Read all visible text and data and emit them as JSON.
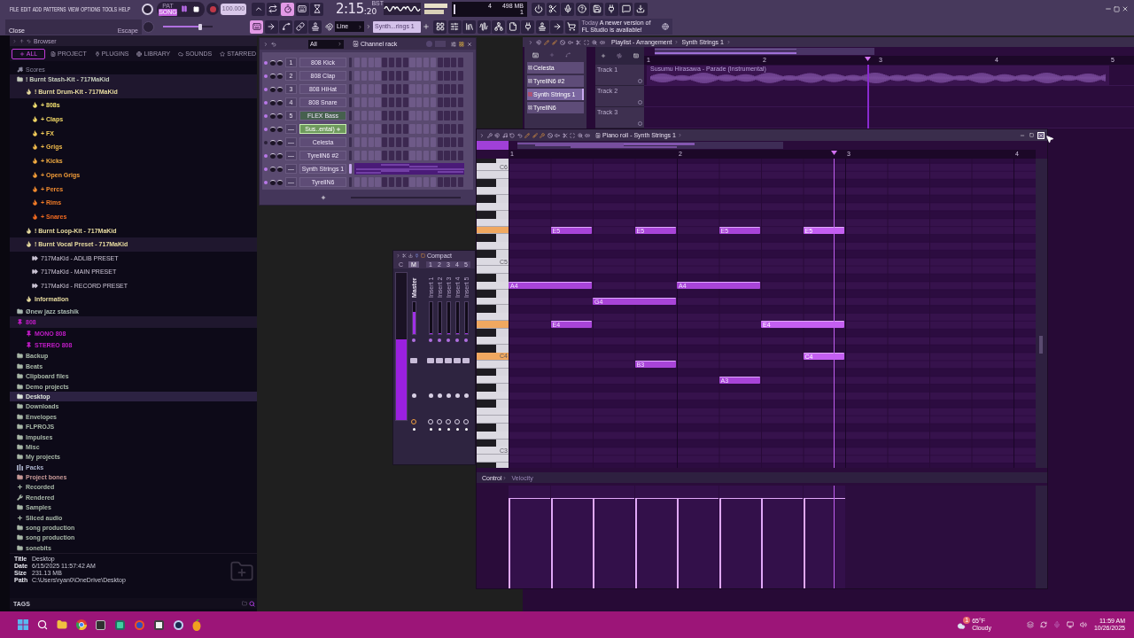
{
  "menu": {
    "items": [
      "FILE",
      "EDIT",
      "ADD",
      "PATTERNS",
      "VIEW",
      "OPTIONS",
      "TOOLS",
      "HELP"
    ],
    "hint": "Close",
    "shortcut": "Escape"
  },
  "transport": {
    "modes": [
      {
        "label": "PAT",
        "selected": false
      },
      {
        "label": "SONG",
        "selected": true
      }
    ],
    "playing": true,
    "recording": false,
    "tempo": "100.000",
    "time": "2:15",
    "ticks": ":20",
    "time_unit": "BST",
    "master_pitch": {
      "level": 0.75
    },
    "toggles": [
      {
        "on": false
      },
      {
        "on": false
      },
      {
        "on": true
      },
      {
        "on": false
      },
      {
        "on": false
      }
    ],
    "edit_toggles": [
      {
        "on": true
      },
      {
        "on": false
      },
      {
        "on": false
      },
      {
        "on": false
      },
      {
        "on": false
      }
    ],
    "snap": "Line",
    "pattern": "Synth...rings 1"
  },
  "cpu": {
    "cores": "4",
    "memory": "498 MB",
    "polyphony": "1"
  },
  "notification": {
    "day": "Today",
    "text": "A newer version of FL Studio is available!"
  },
  "browser": {
    "title": "Browser",
    "tabs": [
      {
        "label": "ALL",
        "selected": true
      },
      {
        "label": "PROJECT",
        "selected": false
      },
      {
        "label": "PLUGINS",
        "selected": false
      },
      {
        "label": "LIBRARY",
        "selected": false
      },
      {
        "label": "SOUNDS",
        "selected": false
      },
      {
        "label": "STARRED",
        "selected": false
      }
    ],
    "tree": [
      {
        "label": "Scores",
        "kind": "note",
        "color": "#8c8aa0",
        "selected": false,
        "expanded": false
      },
      {
        "label": "! Burnt Stash-Kit - 717MaKid",
        "kind": "folder",
        "color": "#c4ccbc",
        "selected": false,
        "expanded": true,
        "children": [
          {
            "label": "! Burnt Drum-Kit - 717MaKid",
            "kind": "flame",
            "color": "#e8dca0",
            "selected": false,
            "expanded": true,
            "children": [
              {
                "label": "+ 808s",
                "kind": "flame",
                "color": "#f2e070",
                "selected": false,
                "expanded": false
              },
              {
                "label": "+ Claps",
                "kind": "flame",
                "color": "#f2d866",
                "selected": false,
                "expanded": false
              },
              {
                "label": "+ FX",
                "kind": "flame",
                "color": "#f2cc5a",
                "selected": false,
                "expanded": false
              },
              {
                "label": "+ Grigs",
                "kind": "flame",
                "color": "#f2bc4c",
                "selected": false,
                "expanded": false
              },
              {
                "label": "+ Kicks",
                "kind": "flame",
                "color": "#f2ac42",
                "selected": false,
                "expanded": false
              },
              {
                "label": "+ Open Grigs",
                "kind": "flame",
                "color": "#f29c38",
                "selected": false,
                "expanded": false
              },
              {
                "label": "+ Percs",
                "kind": "flame",
                "color": "#f28c30",
                "selected": false,
                "expanded": false
              },
              {
                "label": "+ Rims",
                "kind": "flame",
                "color": "#f27c28",
                "selected": false,
                "expanded": false
              },
              {
                "label": "+ Snares",
                "kind": "flame",
                "color": "#f26a20",
                "selected": false,
                "expanded": false
              }
            ]
          },
          {
            "label": "! Burnt Loop-Kit - 717MaKid",
            "kind": "flame",
            "color": "#e8dca0",
            "selected": false,
            "expanded": false
          },
          {
            "label": "! Burnt Vocal Preset - 717MaKid",
            "kind": "flame",
            "color": "#e8dca0",
            "selected": false,
            "expanded": true,
            "children": [
              {
                "label": "717MaKid - ADLIB PRESET",
                "kind": "preset",
                "color": "#cfc8d8",
                "selected": false,
                "expanded": false
              },
              {
                "label": "717MaKid - MAIN PRESET",
                "kind": "preset",
                "color": "#cfc8d8",
                "selected": false,
                "expanded": false
              },
              {
                "label": "717MaKid - RECORD PRESET",
                "kind": "preset",
                "color": "#cfc8d8",
                "selected": false,
                "expanded": false
              }
            ]
          },
          {
            "label": "Information",
            "kind": "flame",
            "color": "#e8dca0",
            "selected": false,
            "expanded": false
          }
        ]
      },
      {
        "label": "Ønew jazz stashik",
        "kind": "folder",
        "color": "#a8b8b0",
        "selected": false,
        "expanded": false
      },
      {
        "label": "808",
        "kind": "pin",
        "color": "#c21cc8",
        "selected": false,
        "expanded": true,
        "children": [
          {
            "label": "MONO 808",
            "kind": "pin",
            "color": "#c21cc8",
            "selected": false,
            "expanded": false
          },
          {
            "label": "STEREO 808",
            "kind": "pin",
            "color": "#c21cc8",
            "selected": false,
            "expanded": false
          }
        ]
      },
      {
        "label": "Backup",
        "kind": "folder",
        "color": "#a8b8a8",
        "selected": false,
        "expanded": false
      },
      {
        "label": "Beats",
        "kind": "folder",
        "color": "#a8b8a8",
        "selected": false,
        "expanded": false
      },
      {
        "label": "Clipboard files",
        "kind": "folder",
        "color": "#a8b8a8",
        "selected": false,
        "expanded": false
      },
      {
        "label": "Demo projects",
        "kind": "folder",
        "color": "#a8b8a8",
        "selected": false,
        "expanded": false
      },
      {
        "label": "Desktop",
        "kind": "folder",
        "color": "#dce4dc",
        "selected": true,
        "expanded": false
      },
      {
        "label": "Downloads",
        "kind": "folder",
        "color": "#a8b8a8",
        "selected": false,
        "expanded": false
      },
      {
        "label": "Envelopes",
        "kind": "folder",
        "color": "#a8b8a8",
        "selected": false,
        "expanded": false
      },
      {
        "label": "FLPROJS",
        "kind": "folder",
        "color": "#a8b8a8",
        "selected": false,
        "expanded": false
      },
      {
        "label": "Impulses",
        "kind": "folder",
        "color": "#a8b8a8",
        "selected": false,
        "expanded": false
      },
      {
        "label": "Misc",
        "kind": "folder",
        "color": "#a8b8a8",
        "selected": false,
        "expanded": false
      },
      {
        "label": "My projects",
        "kind": "folder",
        "color": "#a8b8a8",
        "selected": false,
        "expanded": false
      },
      {
        "label": "Packs",
        "kind": "packs",
        "color": "#a8b0c8",
        "selected": false,
        "expanded": false
      },
      {
        "label": "Project bones",
        "kind": "folder",
        "color": "#c89a98",
        "selected": false,
        "expanded": false
      },
      {
        "label": "Recorded",
        "kind": "plus",
        "color": "#a8b8a8",
        "selected": false,
        "expanded": false
      },
      {
        "label": "Rendered",
        "kind": "tool",
        "color": "#a8b8a8",
        "selected": false,
        "expanded": false
      },
      {
        "label": "Samples",
        "kind": "folder",
        "color": "#a8b8a8",
        "selected": false,
        "expanded": false
      },
      {
        "label": "Sliced audio",
        "kind": "plus",
        "color": "#a8b8a8",
        "selected": false,
        "expanded": false
      },
      {
        "label": "song production",
        "kind": "folder",
        "color": "#a8b8a8",
        "selected": false,
        "expanded": false
      },
      {
        "label": "song production",
        "kind": "folder",
        "color": "#a8b8a8",
        "selected": false,
        "expanded": false
      },
      {
        "label": "sonebits",
        "kind": "folder",
        "color": "#a8b8a8",
        "selected": false,
        "expanded": false
      }
    ],
    "info": [
      {
        "label": "Title",
        "value": "Desktop"
      },
      {
        "label": "Date",
        "value": "6/15/2025 11:57:42 AM"
      },
      {
        "label": "Size",
        "value": "231.13 MB"
      },
      {
        "label": "Path",
        "value": "C:\\Users\\ryan0\\OneDrive\\Desktop"
      }
    ],
    "tags": "TAGS"
  },
  "channel_rack": {
    "filter": "All",
    "title": "Channel rack",
    "channels": [
      {
        "number": "1",
        "name": "808 Kick",
        "color": "#5e4c76",
        "enabled": true,
        "selected": false,
        "hovered": false,
        "kind": "steps"
      },
      {
        "number": "2",
        "name": "808 Clap",
        "color": "#5e4c76",
        "enabled": true,
        "selected": false,
        "hovered": false,
        "kind": "steps"
      },
      {
        "number": "3",
        "name": "808 HiHat",
        "color": "#5e4c76",
        "enabled": true,
        "selected": false,
        "hovered": false,
        "kind": "steps"
      },
      {
        "number": "4",
        "name": "808 Snare",
        "color": "#5e4c76",
        "enabled": true,
        "selected": false,
        "hovered": false,
        "kind": "steps"
      },
      {
        "number": "5",
        "name": "FLEX Bass",
        "color": "#46604e",
        "enabled": true,
        "selected": false,
        "hovered": false,
        "kind": "steps"
      },
      {
        "number": "—",
        "name": "Sus..ental)",
        "color": "#6e9a5c",
        "enabled": true,
        "selected": false,
        "hovered": true,
        "kind": "steps"
      },
      {
        "number": "—",
        "name": "Celesta",
        "color": "#5e4c76",
        "enabled": false,
        "selected": false,
        "hovered": false,
        "kind": "steps"
      },
      {
        "number": "—",
        "name": "TyrellN6 #2",
        "color": "#5e4c76",
        "enabled": true,
        "selected": false,
        "hovered": false,
        "kind": "steps"
      },
      {
        "number": "—",
        "name": "Synth Strings 1",
        "color": "#5e4c76",
        "enabled": true,
        "selected": true,
        "hovered": false,
        "kind": "pianoroll"
      },
      {
        "number": "—",
        "name": "TyrellN6",
        "color": "#5e4c76",
        "enabled": true,
        "selected": false,
        "hovered": false,
        "kind": "steps"
      }
    ]
  },
  "mixer": {
    "view": "Compact",
    "current": "C",
    "meter": {
      "level": 0.55
    },
    "tracks": [
      {
        "number": "M",
        "name": "Master",
        "kind": "master",
        "level": 0.7
      },
      {
        "number": "1",
        "name": "Insert 1",
        "kind": "insert",
        "level": 0
      },
      {
        "number": "2",
        "name": "Insert 2",
        "kind": "insert",
        "level": 0
      },
      {
        "number": "3",
        "name": "Insert 3",
        "kind": "insert",
        "level": 0
      },
      {
        "number": "4",
        "name": "Insert 4",
        "kind": "insert",
        "level": 0
      },
      {
        "number": "5",
        "name": "Insert 5",
        "kind": "insert",
        "level": 0
      }
    ]
  },
  "playlist": {
    "title": "Playlist - Arrangement",
    "pattern": "Synth Strings 1",
    "patterns": [
      {
        "name": "Celesta",
        "selected": false
      },
      {
        "name": "TyrellN6 #2",
        "selected": false
      },
      {
        "name": "Synth Strings 1",
        "selected": true
      },
      {
        "name": "TyrellN6",
        "selected": false
      }
    ],
    "ruler": [
      "1",
      "2",
      "3",
      "4",
      "5"
    ],
    "tracks": [
      {
        "name": "Track 1",
        "clip": "Susumu Hirasawa - Parade (Instrumental)"
      },
      {
        "name": "Track 2"
      },
      {
        "name": "Track 3"
      }
    ]
  },
  "piano_roll": {
    "title": "Piano roll - Synth Strings 1",
    "ruler": [
      "1",
      "2",
      "3",
      "4"
    ],
    "key_labels": [
      "C6",
      "C5",
      "C4",
      "C3"
    ],
    "notes": [
      {
        "label": "E5",
        "playing": false
      },
      {
        "label": "E5",
        "playing": false
      },
      {
        "label": "E5",
        "playing": false
      },
      {
        "label": "E5",
        "playing": true
      },
      {
        "label": "A4",
        "playing": false
      },
      {
        "label": "A4",
        "playing": false
      },
      {
        "label": "G4",
        "playing": false
      },
      {
        "label": "E4",
        "playing": false
      },
      {
        "label": "E4",
        "playing": true
      },
      {
        "label": "C4",
        "playing": true
      },
      {
        "label": "B3",
        "playing": false
      },
      {
        "label": "A3",
        "playing": false
      }
    ],
    "control": "Control",
    "parameter": "Velocity",
    "velocities": [
      {
        "level": 0.88
      },
      {
        "level": 0.88
      },
      {
        "level": 0.88
      },
      {
        "level": 0.88
      },
      {
        "level": 0.88
      },
      {
        "level": 0.88
      },
      {
        "level": 0.88
      },
      {
        "level": 0.88
      }
    ]
  },
  "taskbar": {
    "weather": {
      "badge": "1",
      "temperature": "65°F",
      "condition": "Cloudy"
    },
    "clock": {
      "time": "11:59 AM",
      "date": "10/26/2025"
    }
  }
}
